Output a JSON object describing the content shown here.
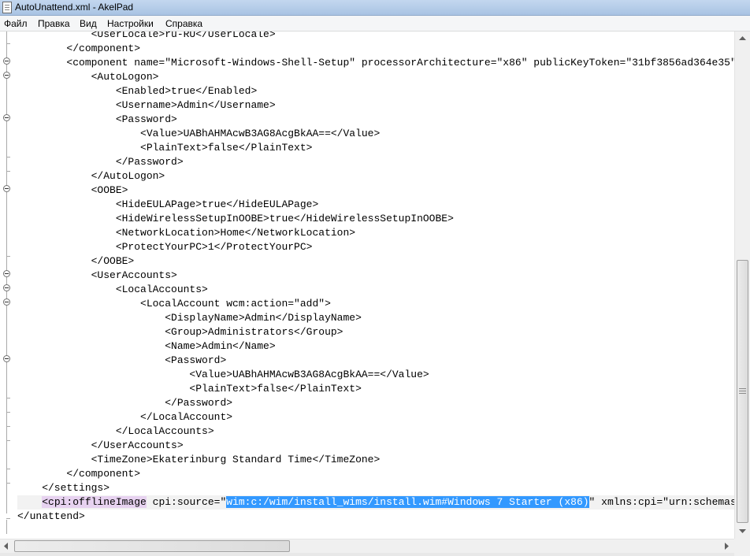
{
  "window": {
    "title": "AutoUnattend.xml - AkelPad"
  },
  "menu": {
    "items": [
      "Файл",
      "Правка",
      "Вид",
      "Настройки",
      "Справка"
    ]
  },
  "editor": {
    "lines": [
      "            <UserLocale>ru-RU</UserLocale>",
      "        </component>",
      "        <component name=\"Microsoft-Windows-Shell-Setup\" processorArchitecture=\"x86\" publicKeyToken=\"31bf3856ad364e35\"",
      "            <AutoLogon>",
      "                <Enabled>true</Enabled>",
      "                <Username>Admin</Username>",
      "                <Password>",
      "                    <Value>UABhAHMAcwB3AG8AcgBkAA==</Value>",
      "                    <PlainText>false</PlainText>",
      "                </Password>",
      "            </AutoLogon>",
      "            <OOBE>",
      "                <HideEULAPage>true</HideEULAPage>",
      "                <HideWirelessSetupInOOBE>true</HideWirelessSetupInOOBE>",
      "                <NetworkLocation>Home</NetworkLocation>",
      "                <ProtectYourPC>1</ProtectYourPC>",
      "            </OOBE>",
      "            <UserAccounts>",
      "                <LocalAccounts>",
      "                    <LocalAccount wcm:action=\"add\">",
      "                        <DisplayName>Admin</DisplayName>",
      "                        <Group>Administrators</Group>",
      "                        <Name>Admin</Name>",
      "                        <Password>",
      "                            <Value>UABhAHMAcwB3AG8AcgBkAA==</Value>",
      "                            <PlainText>false</PlainText>",
      "                        </Password>",
      "                    </LocalAccount>",
      "                </LocalAccounts>",
      "            </UserAccounts>",
      "            <TimeZone>Ekaterinburg Standard Time</TimeZone>",
      "        </component>",
      "    </settings>",
      "",
      "</unattend>"
    ],
    "current_line": {
      "indent": "    ",
      "tag": "<cpi:offlineImage",
      "attr_before": " cpi:source=\"",
      "selected": "wim:c:/wim/install_wims/install.wim#Windows 7 Starter (x86)",
      "attr_after": "\" xmlns:cpi=\"urn:schemas-microsoft-com:cpi\" />"
    }
  }
}
